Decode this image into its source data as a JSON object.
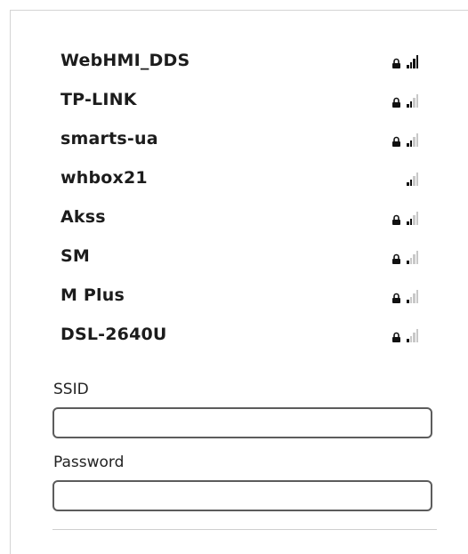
{
  "networks": [
    {
      "ssid": "WebHMI_DDS",
      "secured": true,
      "strength": 4
    },
    {
      "ssid": "TP-LINK",
      "secured": true,
      "strength": 2
    },
    {
      "ssid": "smarts-ua",
      "secured": true,
      "strength": 2
    },
    {
      "ssid": "whbox21",
      "secured": false,
      "strength": 2
    },
    {
      "ssid": "Akss",
      "secured": true,
      "strength": 2
    },
    {
      "ssid": "SM",
      "secured": true,
      "strength": 1
    },
    {
      "ssid": "M Plus",
      "secured": true,
      "strength": 1
    },
    {
      "ssid": "DSL-2640U",
      "secured": true,
      "strength": 1
    }
  ],
  "form": {
    "ssid_label": "SSID",
    "ssid_value": "",
    "password_label": "Password",
    "password_value": ""
  },
  "icons": {
    "lock": "lock-icon",
    "signal": "wifi-signal-icon"
  },
  "colors": {
    "signal_on": "#111111",
    "signal_off": "#c8c8c8",
    "text": "#1c1c1c",
    "field_border": "#5c5c5c"
  }
}
